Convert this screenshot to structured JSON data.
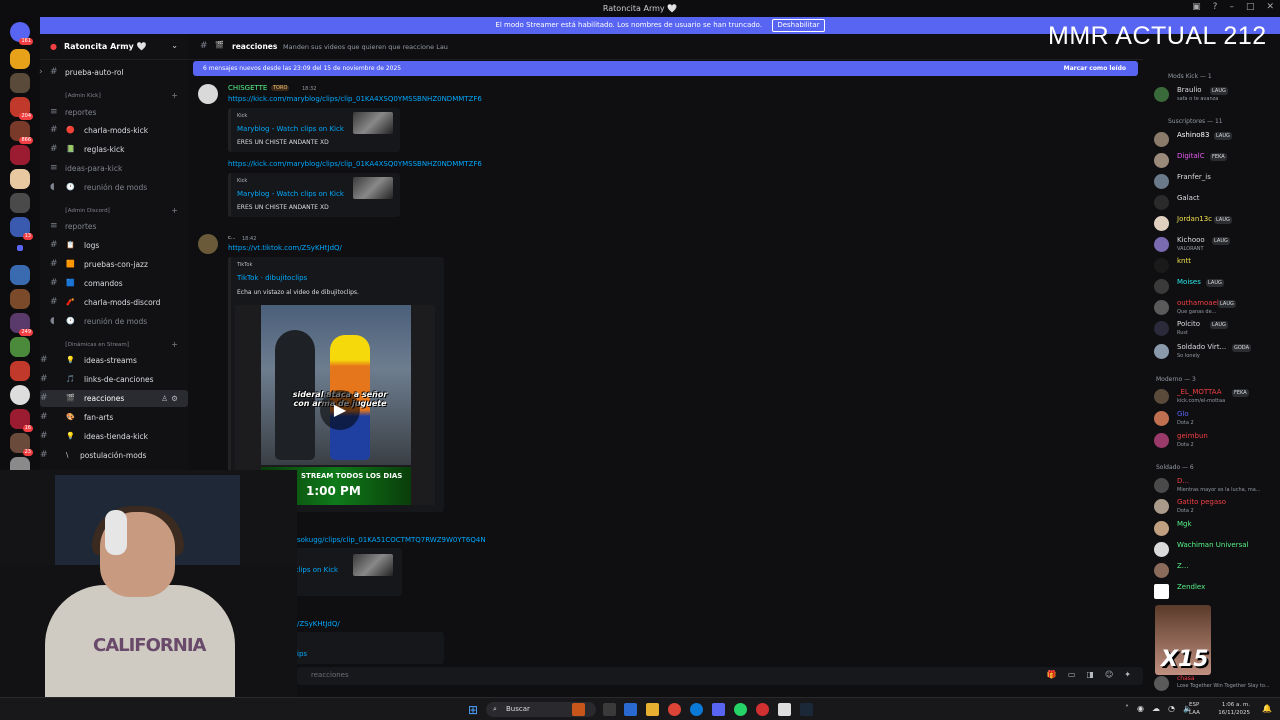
{
  "window": {
    "title": "Ratoncita Army 🤍"
  },
  "banner": {
    "text": "El modo Streamer está habilitado. Los nombres de usuario se han truncado.",
    "button": "Deshabilitar"
  },
  "overlay": {
    "mmr": "MMR ACTUAL 212"
  },
  "guild_badges": [
    "161",
    "204",
    "866",
    "13",
    "249",
    "16",
    "23"
  ],
  "server": {
    "name": "Ratoncita Army 🤍"
  },
  "channels": [
    {
      "name": "prueba-auto-rol",
      "emoji": ""
    },
    {
      "name": "reportes",
      "emoji": ""
    },
    {
      "name": "charla-mods-kick",
      "emoji": "🔴"
    },
    {
      "name": "reglas-kick",
      "emoji": "📗"
    },
    {
      "name": "ideas-para-kick",
      "emoji": ""
    },
    {
      "name": "reunión de mods",
      "emoji": "🕐"
    },
    {
      "name": "reportes",
      "emoji": ""
    },
    {
      "name": "logs",
      "emoji": "📋"
    },
    {
      "name": "pruebas-con-jazz",
      "emoji": "🟧"
    },
    {
      "name": "comandos",
      "emoji": "🟦"
    },
    {
      "name": "charla-mods-discord",
      "emoji": "🧨"
    },
    {
      "name": "reunión de mods",
      "emoji": "🕐"
    },
    {
      "name": "ideas-streams",
      "emoji": "💡"
    },
    {
      "name": "links-de-canciones",
      "emoji": "🎵"
    },
    {
      "name": "reacciones",
      "emoji": "🎬"
    },
    {
      "name": "fan-arts",
      "emoji": "🎨"
    },
    {
      "name": "ideas-tienda-kick",
      "emoji": "💡"
    },
    {
      "name": "postulación-mods",
      "emoji": "\\"
    }
  ],
  "categories": [
    "⟦Admin Kick⟧",
    "⟦Admin Discord⟧",
    "⟦Dinámicas en Stream⟧"
  ],
  "topbar": {
    "channel": "reacciones",
    "topic": "Manden sus videos que quieren que reaccione Lau"
  },
  "new_messages": {
    "text": "6 mensajes nuevos desde las 23:09 del 15 de noviembre de 2025",
    "action": "Marcar como leído"
  },
  "messages": {
    "m1": {
      "user": "CHISGETTE",
      "badge": "TORO",
      "time": "18:32",
      "link": "https://kick.com/maryblog/clips/clip_01KA4XSQ0YMSSBNHZ0NDMMTZF6"
    },
    "embed1": {
      "provider": "Kick",
      "title": "Maryblog - Watch clips on Kick",
      "desc": "ERES UN CHISTE ANDANTE XD"
    },
    "m2": {
      "link": "https://kick.com/maryblog/clips/clip_01KA4XSQ0YMSSBNHZ0NDMMTZF6"
    },
    "embed2": {
      "provider": "Kick",
      "title": "Maryblog - Watch clips on Kick",
      "desc": "ERES UN CHISTE ANDANTE XD"
    },
    "m3": {
      "user": "c...",
      "time": "18:42",
      "link": "https://vt.tiktok.com/ZSyKHtJdQ/"
    },
    "embed3": {
      "provider": "TikTok",
      "title": "TikTok · dibujitoclips",
      "desc": "Echa un vistazo al video de dibujitoclips."
    },
    "video": {
      "caption": "sideral ataca a señor con arma de juguete",
      "ad_line1": "STREAM TODOS LOS DIAS",
      "ad_line2": "1:00 PM"
    },
    "m4": {
      "link": "sokugg/clips/clip_01KA51COCTMTQ7RWZ9W0YT6Q4N",
      "embed_title": "n clips on Kick"
    },
    "m5": {
      "link": "/ZSyKHtJdQ/",
      "embed_title": "ips"
    }
  },
  "input": {
    "placeholder": "reacciones"
  },
  "members": {
    "groups": [
      {
        "title": "Mods Kick — 1"
      },
      {
        "title": "Suscriptores — 11"
      },
      {
        "title": "Moderno — 3"
      },
      {
        "title": "Soldado — 6"
      }
    ],
    "list": [
      {
        "name": "Braulio",
        "badge": "LAUG",
        "sub": "safa o te avanza",
        "color": "#dbdee1"
      },
      {
        "name": "Ashino83",
        "badge": "LAUG",
        "sub": "",
        "color": "#ffffff"
      },
      {
        "name": "DigitalC",
        "badge": "FEKA",
        "sub": "",
        "color": "#e55cf0"
      },
      {
        "name": "Franfer_is",
        "badge": "",
        "sub": "",
        "color": "#dbdee1"
      },
      {
        "name": "Galact",
        "badge": "",
        "sub": "",
        "color": "#dbdee1"
      },
      {
        "name": "Jordan13c",
        "badge": "LAUG",
        "sub": "",
        "color": "#f0e14a"
      },
      {
        "name": "Kichooo",
        "badge": "LAUG",
        "sub": "VALORANT",
        "color": "#dbdee1"
      },
      {
        "name": "kntt",
        "badge": "",
        "sub": "",
        "color": "#f0e14a"
      },
      {
        "name": "Moises",
        "badge": "LAUG",
        "sub": "",
        "color": "#2ee8ea"
      },
      {
        "name": "outhamoael",
        "badge": "LAUG",
        "sub": "Que ganas de...",
        "color": "#f23f43"
      },
      {
        "name": "Polcito",
        "badge": "LAUG",
        "sub": "Rust",
        "color": "#dbdee1"
      },
      {
        "name": "Soldado Virt...",
        "badge": "GODA",
        "sub": "So lonely",
        "color": "#dbdee1"
      },
      {
        "name": "_EL_MOTTAA",
        "badge": "FEKA",
        "sub": "kick.com/el-mottaa",
        "color": "#f23f43"
      },
      {
        "name": "Glo",
        "badge": "",
        "sub": "Dota 2",
        "color": "#5865f2"
      },
      {
        "name": "geimbun",
        "badge": "",
        "sub": "Dota 2",
        "color": "#f23f43"
      },
      {
        "name": "D...",
        "badge": "",
        "sub": "Mientras mayor es la lucha, ma...",
        "color": "#f23f43"
      },
      {
        "name": "Gatito pegaso",
        "badge": "",
        "sub": "Dota 2",
        "color": "#f23f43"
      },
      {
        "name": "Mgk",
        "badge": "",
        "sub": "",
        "color": "#57f287"
      },
      {
        "name": "Wachiman Universal",
        "badge": "",
        "sub": "",
        "color": "#57f287"
      },
      {
        "name": "Z...",
        "badge": "",
        "sub": "",
        "color": "#57f287"
      },
      {
        "name": "Zendlex",
        "badge": "",
        "sub": "",
        "color": "#57f287"
      },
      {
        "name": "chasa",
        "badge": "",
        "sub": "Lose Together Win Together Slay to...",
        "color": "#f23f43"
      }
    ]
  },
  "webcam": {
    "shirt": "CALIFORNIA"
  },
  "emote": {
    "text": "X15"
  },
  "taskbar": {
    "search": "Buscar",
    "lang1": "ESP",
    "lang2": "LAA",
    "time": "1:06 a. m.",
    "date": "16/11/2025"
  }
}
